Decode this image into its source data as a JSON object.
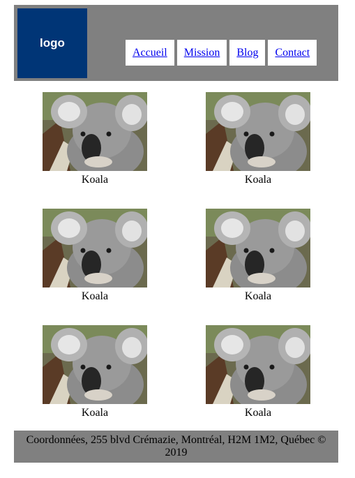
{
  "header": {
    "logo_text": "logo",
    "nav": [
      {
        "label": "Accueil"
      },
      {
        "label": "Mission"
      },
      {
        "label": "Blog"
      },
      {
        "label": "Contact"
      }
    ]
  },
  "gallery": {
    "items": [
      {
        "caption": "Koala"
      },
      {
        "caption": "Koala"
      },
      {
        "caption": "Koala"
      },
      {
        "caption": "Koala"
      },
      {
        "caption": "Koala"
      },
      {
        "caption": "Koala"
      }
    ]
  },
  "footer": {
    "text": "Coordonnées, 255 blvd Crémazie, Montréal, H2M 1M2, Québec © 2019"
  },
  "colors": {
    "header_bg": "#808080",
    "logo_bg": "#003576",
    "link": "#0000ee"
  }
}
